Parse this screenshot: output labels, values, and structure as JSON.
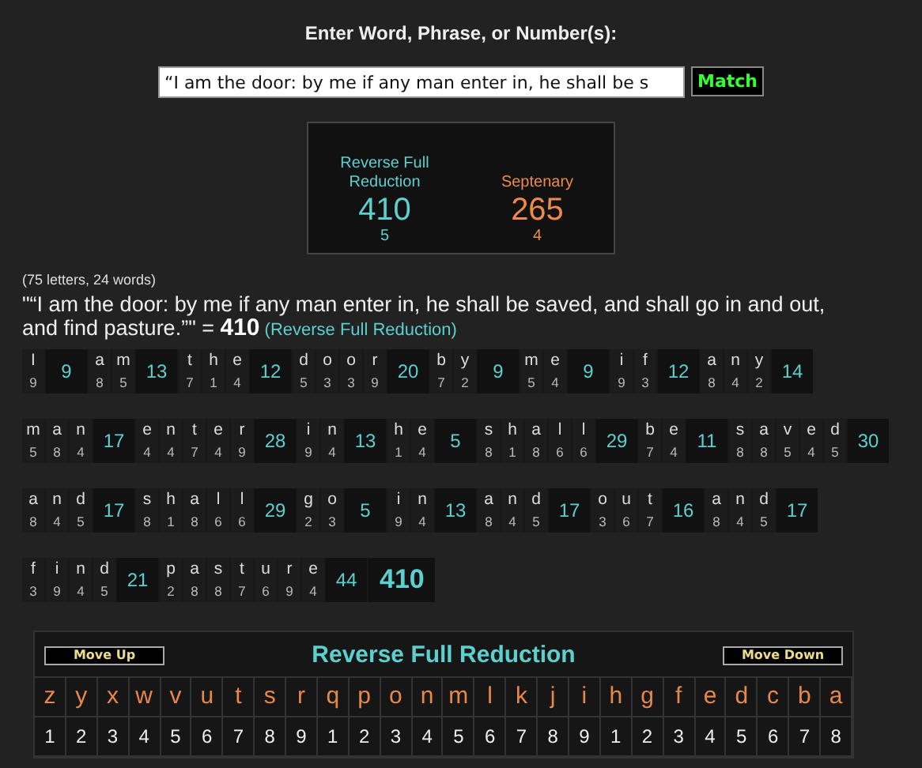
{
  "heading": "Enter Word, Phrase, or Number(s):",
  "input": {
    "value": "“I am the door: by me if any man enter in, he shall be s"
  },
  "match_button": "Match",
  "results": [
    {
      "cipher": "Reverse Full Reduction",
      "value": "410",
      "words": "5",
      "color": "#5ccfcf"
    },
    {
      "cipher": "Septenary",
      "value": "265",
      "words": "4",
      "color": "#ee8a4a"
    }
  ],
  "counts": "(75 letters, 24 words)",
  "phrase": "\"“I am the door: by me if any man enter in, he shall be saved, and shall go in and out, and find pasture.”\"",
  "equals": "=",
  "total": "410",
  "phrase_cipher": "(Reverse Full Reduction)",
  "breakdown_rows": [
    {
      "words": [
        {
          "letters": [
            [
              "I",
              "9"
            ]
          ],
          "sum": "9"
        },
        {
          "letters": [
            [
              "a",
              "8"
            ],
            [
              "m",
              "5"
            ]
          ],
          "sum": "13"
        },
        {
          "letters": [
            [
              "t",
              "7"
            ],
            [
              "h",
              "1"
            ],
            [
              "e",
              "4"
            ]
          ],
          "sum": "12"
        },
        {
          "letters": [
            [
              "d",
              "5"
            ],
            [
              "o",
              "3"
            ],
            [
              "o",
              "3"
            ],
            [
              "r",
              "9"
            ]
          ],
          "sum": "20"
        },
        {
          "letters": [
            [
              "b",
              "7"
            ],
            [
              "y",
              "2"
            ]
          ],
          "sum": "9"
        },
        {
          "letters": [
            [
              "m",
              "5"
            ],
            [
              "e",
              "4"
            ]
          ],
          "sum": "9"
        },
        {
          "letters": [
            [
              "i",
              "9"
            ],
            [
              "f",
              "3"
            ]
          ],
          "sum": "12"
        },
        {
          "letters": [
            [
              "a",
              "8"
            ],
            [
              "n",
              "4"
            ],
            [
              "y",
              "2"
            ]
          ],
          "sum": "14"
        }
      ]
    },
    {
      "words": [
        {
          "letters": [
            [
              "m",
              "5"
            ],
            [
              "a",
              "8"
            ],
            [
              "n",
              "4"
            ]
          ],
          "sum": "17"
        },
        {
          "letters": [
            [
              "e",
              "4"
            ],
            [
              "n",
              "4"
            ],
            [
              "t",
              "7"
            ],
            [
              "e",
              "4"
            ],
            [
              "r",
              "9"
            ]
          ],
          "sum": "28"
        },
        {
          "letters": [
            [
              "i",
              "9"
            ],
            [
              "n",
              "4"
            ]
          ],
          "sum": "13"
        },
        {
          "letters": [
            [
              "h",
              "1"
            ],
            [
              "e",
              "4"
            ]
          ],
          "sum": "5"
        },
        {
          "letters": [
            [
              "s",
              "8"
            ],
            [
              "h",
              "1"
            ],
            [
              "a",
              "8"
            ],
            [
              "l",
              "6"
            ],
            [
              "l",
              "6"
            ]
          ],
          "sum": "29"
        },
        {
          "letters": [
            [
              "b",
              "7"
            ],
            [
              "e",
              "4"
            ]
          ],
          "sum": "11"
        },
        {
          "letters": [
            [
              "s",
              "8"
            ],
            [
              "a",
              "8"
            ],
            [
              "v",
              "5"
            ],
            [
              "e",
              "4"
            ],
            [
              "d",
              "5"
            ]
          ],
          "sum": "30"
        }
      ]
    },
    {
      "words": [
        {
          "letters": [
            [
              "a",
              "8"
            ],
            [
              "n",
              "4"
            ],
            [
              "d",
              "5"
            ]
          ],
          "sum": "17"
        },
        {
          "letters": [
            [
              "s",
              "8"
            ],
            [
              "h",
              "1"
            ],
            [
              "a",
              "8"
            ],
            [
              "l",
              "6"
            ],
            [
              "l",
              "6"
            ]
          ],
          "sum": "29"
        },
        {
          "letters": [
            [
              "g",
              "2"
            ],
            [
              "o",
              "3"
            ]
          ],
          "sum": "5"
        },
        {
          "letters": [
            [
              "i",
              "9"
            ],
            [
              "n",
              "4"
            ]
          ],
          "sum": "13"
        },
        {
          "letters": [
            [
              "a",
              "8"
            ],
            [
              "n",
              "4"
            ],
            [
              "d",
              "5"
            ]
          ],
          "sum": "17"
        },
        {
          "letters": [
            [
              "o",
              "3"
            ],
            [
              "u",
              "6"
            ],
            [
              "t",
              "7"
            ]
          ],
          "sum": "16"
        },
        {
          "letters": [
            [
              "a",
              "8"
            ],
            [
              "n",
              "4"
            ],
            [
              "d",
              "5"
            ]
          ],
          "sum": "17"
        }
      ]
    },
    {
      "words": [
        {
          "letters": [
            [
              "f",
              "3"
            ],
            [
              "i",
              "9"
            ],
            [
              "n",
              "4"
            ],
            [
              "d",
              "5"
            ]
          ],
          "sum": "21"
        },
        {
          "letters": [
            [
              "p",
              "2"
            ],
            [
              "a",
              "8"
            ],
            [
              "s",
              "8"
            ],
            [
              "t",
              "7"
            ],
            [
              "u",
              "6"
            ],
            [
              "r",
              "9"
            ],
            [
              "e",
              "4"
            ]
          ],
          "sum": "44"
        }
      ],
      "total": "410"
    }
  ],
  "cipher_table": {
    "move_up": "Move Up",
    "title": "Reverse Full Reduction",
    "move_down": "Move Down",
    "letters": [
      "z",
      "y",
      "x",
      "w",
      "v",
      "u",
      "t",
      "s",
      "r",
      "q",
      "p",
      "o",
      "n",
      "m",
      "l",
      "k",
      "j",
      "i",
      "h",
      "g",
      "f",
      "e",
      "d",
      "c",
      "b",
      "a"
    ],
    "values": [
      "1",
      "2",
      "3",
      "4",
      "5",
      "6",
      "7",
      "8",
      "9",
      "1",
      "2",
      "3",
      "4",
      "5",
      "6",
      "7",
      "8",
      "9",
      "1",
      "2",
      "3",
      "4",
      "5",
      "6",
      "7",
      "8"
    ]
  }
}
